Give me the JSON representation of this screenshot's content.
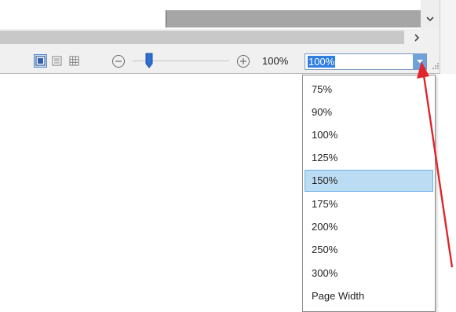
{
  "statusbar": {
    "views": [
      {
        "name": "print-layout-view",
        "active": true
      },
      {
        "name": "web-layout-view",
        "active": false
      },
      {
        "name": "grid-view",
        "active": false
      }
    ],
    "zoom_percent_label": "100%",
    "zoom_level_percent": 100,
    "zoom_combo": {
      "value": "100%",
      "dropdown_icon": "chevron-down-icon"
    }
  },
  "zoom_dropdown": {
    "options": [
      "75%",
      "90%",
      "100%",
      "125%",
      "150%",
      "175%",
      "200%",
      "250%",
      "300%",
      "Page Width"
    ],
    "highlighted": "150%"
  },
  "annotation": {
    "type": "arrow",
    "color": "#e0252c",
    "points_to": "zoom-dropdown-button"
  },
  "colors": {
    "selection_fill": "#bcdcf4",
    "selection_border": "#6fb2e6",
    "combo_text_highlight": "#2f7fe2",
    "combo_button": "#6fa1da",
    "slider_thumb": "#2f6fcf"
  }
}
